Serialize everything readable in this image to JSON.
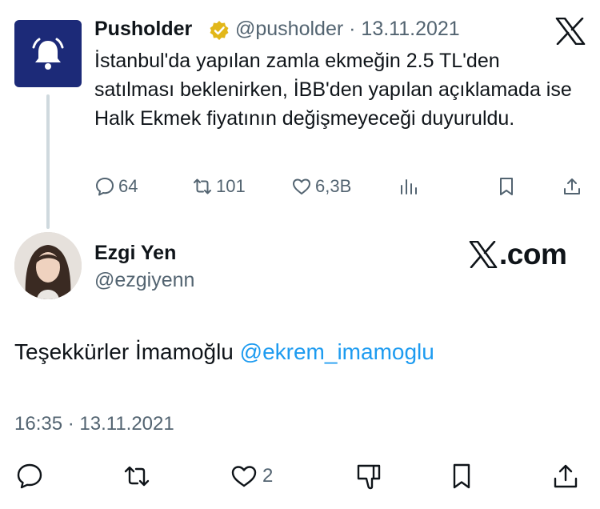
{
  "quoted_tweet": {
    "author_name": "Pusholder",
    "handle": "@pusholder",
    "separator": "·",
    "date": "13.11.2021",
    "text": "İstanbul'da yapılan zamla ekmeğin 2.5 TL'den satılması beklenirken, İBB'den yapılan açıklamada ise Halk Ekmek fiyatının değişmeyeceği duyuruldu.",
    "stats": {
      "replies": "64",
      "retweets": "101",
      "likes": "6,3B"
    },
    "avatar_icon": "bell-icon"
  },
  "reply": {
    "author_name": "Ezgi Yen",
    "handle": "@ezgiyenn",
    "text_main": "Teşekkürler İmamoğlu ",
    "mention": "@ekrem_imamoglu",
    "timestamp": "16:35 · 13.11.2021",
    "likes": "2"
  },
  "branding": {
    "site_suffix": ".com"
  },
  "colors": {
    "accent": "#1d9bf0",
    "muted": "#536471",
    "verified": "#e2b719",
    "bell_bg": "#1c2a78"
  }
}
